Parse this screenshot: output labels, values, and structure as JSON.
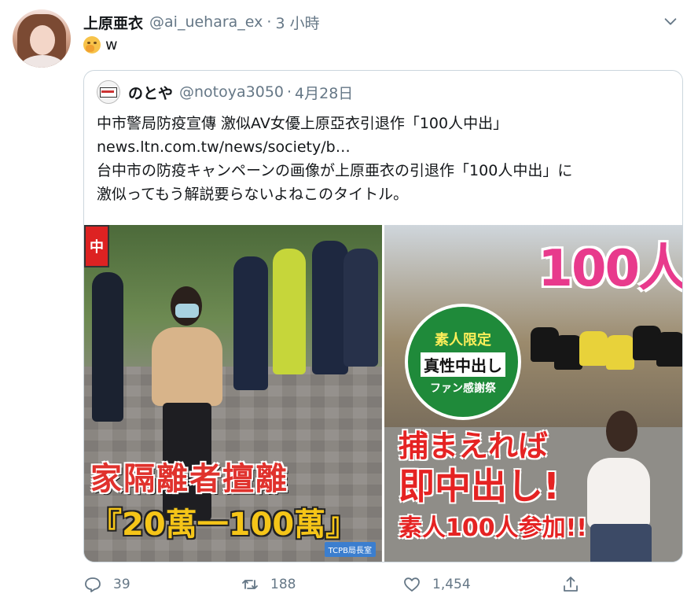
{
  "tweet": {
    "author_name": "上原亜衣",
    "handle": "@ai_uehara_ex",
    "separator": "·",
    "time": "3 小時",
    "text": "w",
    "emoji": "hand-over-mouth-emoji"
  },
  "quote": {
    "author_name": "のとや",
    "handle": "@notoya3050",
    "separator": "·",
    "date": "4月28日",
    "lines": [
      "中市警局防疫宣傳 激似AV女優上原亞衣引退作「100人中出」",
      "news.ltn.com.tw/news/society/b…",
      "台中市の防疫キャンペーンの画像が上原亜衣の引退作「100人中出」に",
      "激似ってもう解説要らないよねこのタイトル。"
    ],
    "image1": {
      "sign": "中",
      "caption_line1": "家隔離者擅離",
      "caption_line2": "『20萬一100萬』",
      "badge": "TCPB局長室"
    },
    "image2": {
      "big_number": "100人",
      "badge_line1": "素人限定",
      "badge_line2": "真性中出し",
      "badge_line3": "ファン感謝祭",
      "catch_line1": "捕まえれば",
      "catch_line2": "即中出し!",
      "catch_line3": "素人100人参加!!"
    }
  },
  "actions": {
    "reply_count": "39",
    "retweet_count": "188",
    "like_count": "1,454"
  },
  "colors": {
    "secondary_text": "#657786",
    "border": "#ccd6dd",
    "primary_text": "#14171a"
  }
}
